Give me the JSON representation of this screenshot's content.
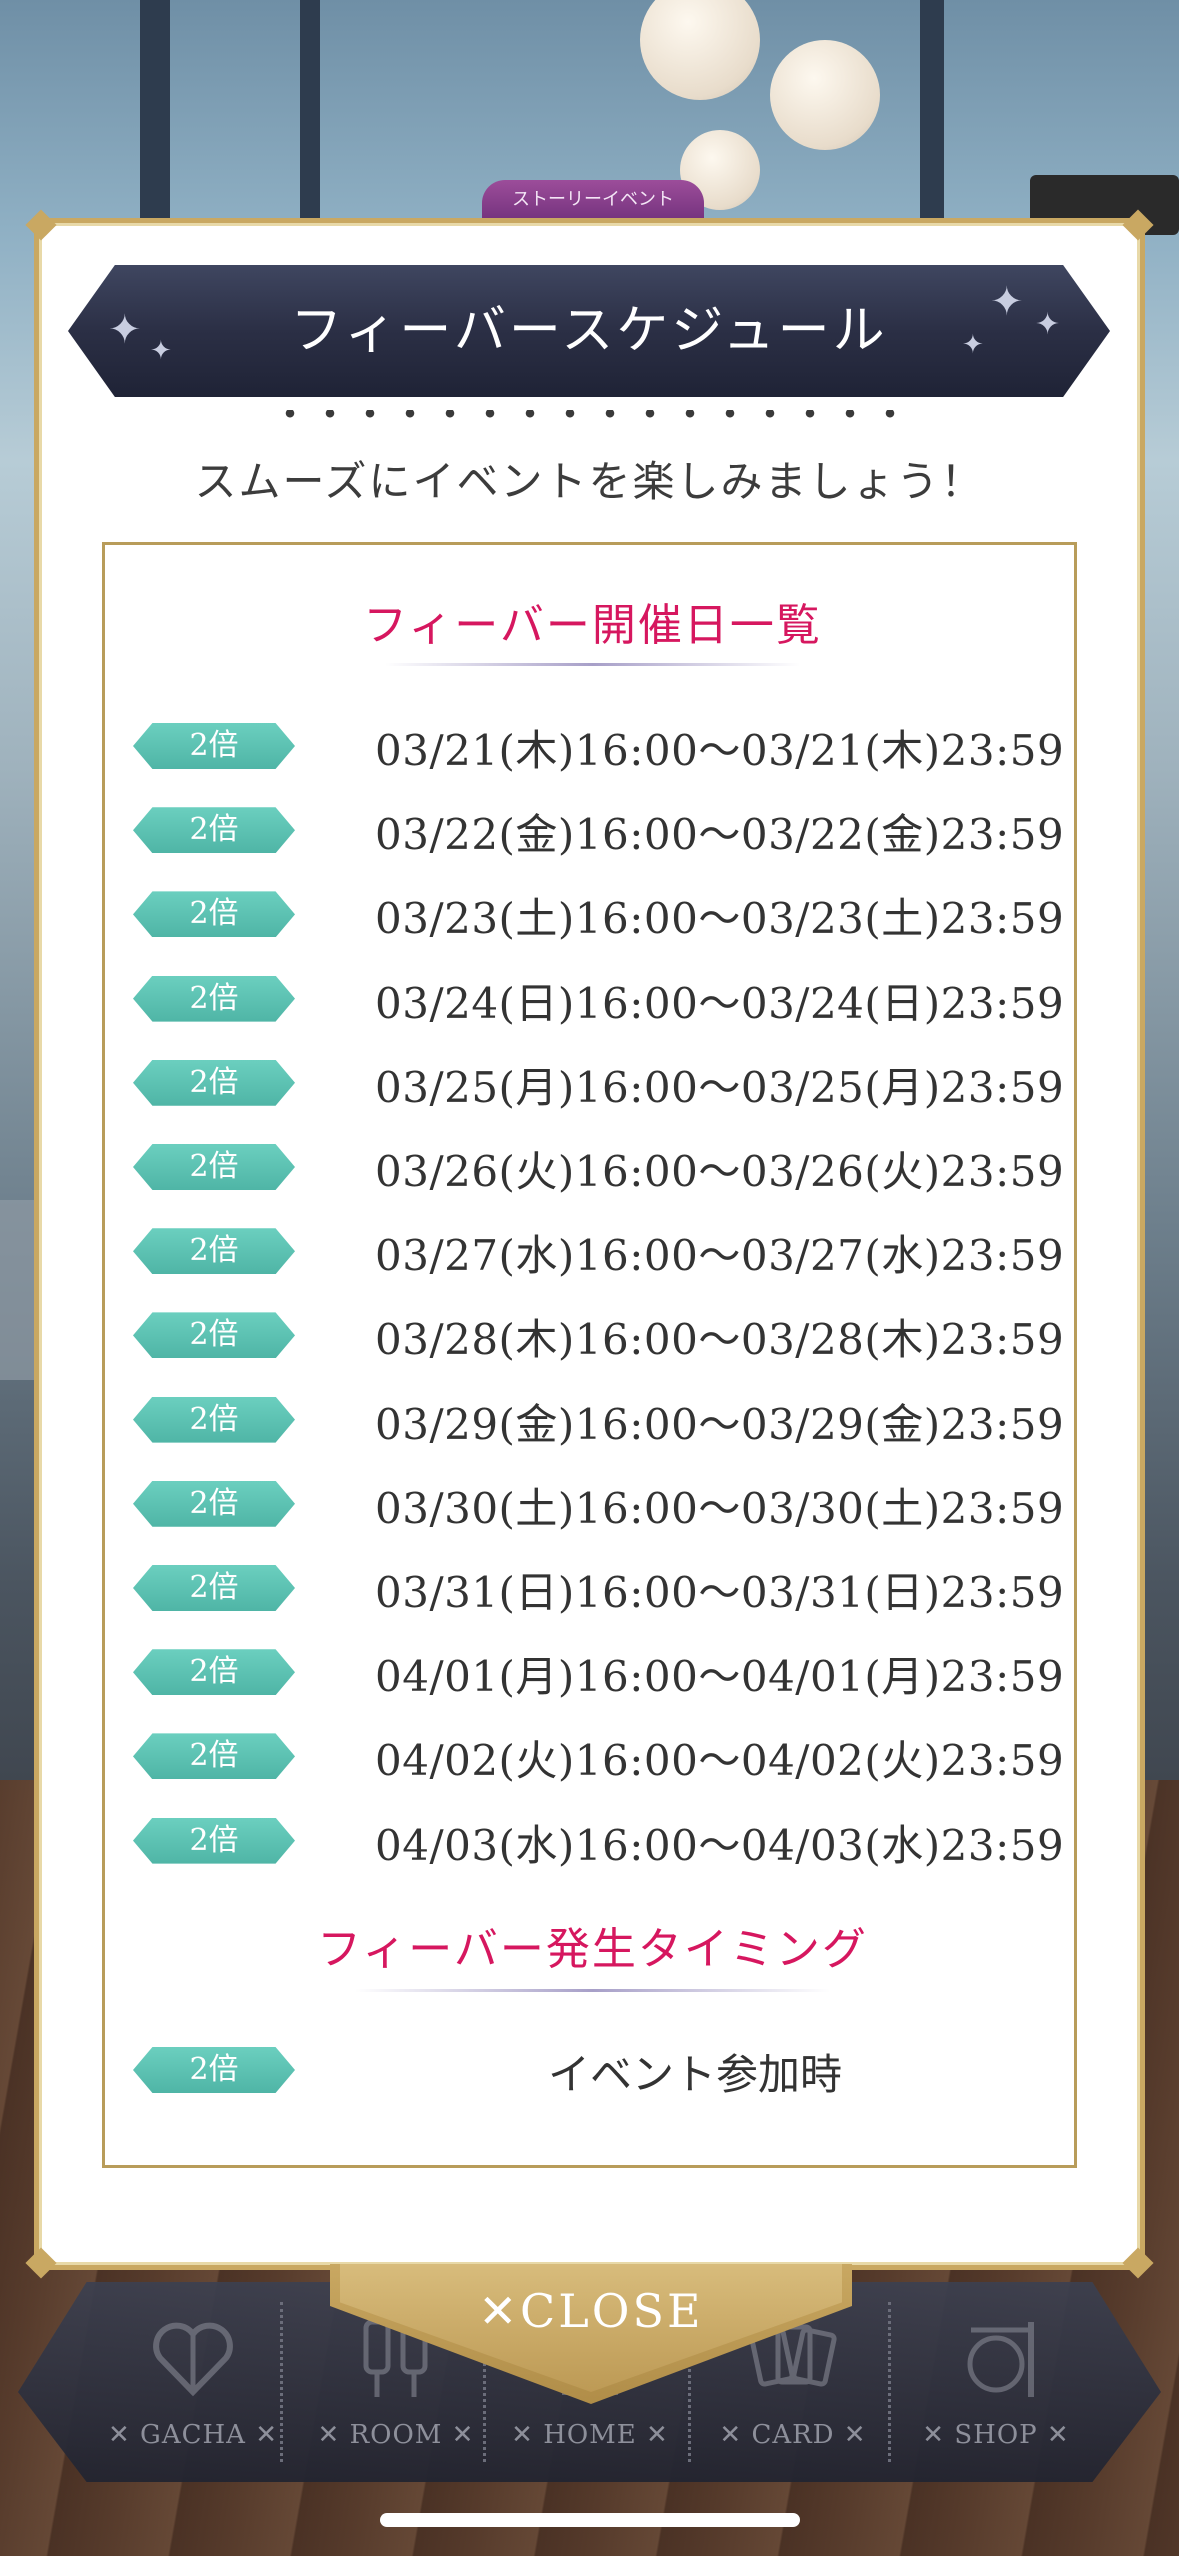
{
  "background": {
    "event_tab_label": "ストーリーイベント"
  },
  "modal": {
    "title": "フィーバースケジュール",
    "intro_cut": "・・・・・・・・・・・・・・・・",
    "intro": "スムーズにイベントを楽しみましょう！",
    "schedule": {
      "title": "フィーバー開催日一覧",
      "rows": [
        {
          "badge": "2倍",
          "period": "03/21(木)16:00〜03/21(木)23:59"
        },
        {
          "badge": "2倍",
          "period": "03/22(金)16:00〜03/22(金)23:59"
        },
        {
          "badge": "2倍",
          "period": "03/23(土)16:00〜03/23(土)23:59"
        },
        {
          "badge": "2倍",
          "period": "03/24(日)16:00〜03/24(日)23:59"
        },
        {
          "badge": "2倍",
          "period": "03/25(月)16:00〜03/25(月)23:59"
        },
        {
          "badge": "2倍",
          "period": "03/26(火)16:00〜03/26(火)23:59"
        },
        {
          "badge": "2倍",
          "period": "03/27(水)16:00〜03/27(水)23:59"
        },
        {
          "badge": "2倍",
          "period": "03/28(木)16:00〜03/28(木)23:59"
        },
        {
          "badge": "2倍",
          "period": "03/29(金)16:00〜03/29(金)23:59"
        },
        {
          "badge": "2倍",
          "period": "03/30(土)16:00〜03/30(土)23:59"
        },
        {
          "badge": "2倍",
          "period": "03/31(日)16:00〜03/31(日)23:59"
        },
        {
          "badge": "2倍",
          "period": "04/01(月)16:00〜04/01(月)23:59"
        },
        {
          "badge": "2倍",
          "period": "04/02(火)16:00〜04/02(火)23:59"
        },
        {
          "badge": "2倍",
          "period": "04/03(水)16:00〜04/03(水)23:59"
        }
      ]
    },
    "timing": {
      "title": "フィーバー発生タイミング",
      "rows": [
        {
          "badge": "2倍",
          "text": "イベント参加時"
        }
      ]
    },
    "close_label": "✕CLOSE"
  },
  "bottom_nav": {
    "items": [
      {
        "label": "✕ GACHA ✕",
        "icon": "gift-heart-icon"
      },
      {
        "label": "✕ ROOM ✕",
        "icon": "mannequin-icon"
      },
      {
        "label": "✕ HOME ✕",
        "icon": "home-icon"
      },
      {
        "label": "✕ CARD ✕",
        "icon": "cards-icon"
      },
      {
        "label": "✕ SHOP ✕",
        "icon": "shop-sign-icon"
      }
    ]
  },
  "colors": {
    "accent_pink": "#d6175f",
    "badge_teal": "#5cc3b3",
    "gold_border": "#c9a862",
    "banner_navy": "#2b2f45"
  }
}
